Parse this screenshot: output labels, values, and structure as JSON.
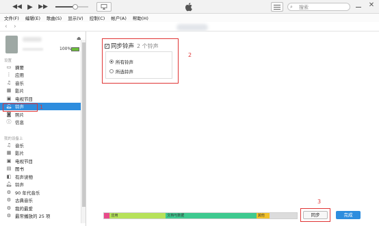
{
  "toolbar": {
    "prev_icon": "rewind-icon",
    "play_icon": "play-icon",
    "next_icon": "fast-forward-icon",
    "volume_level": 0.6,
    "airplay_icon": "airplay-icon",
    "logo_icon": "apple-logo-icon",
    "list_icon": "list-view-icon",
    "search_placeholder": "搜索",
    "search_icon": "search-icon",
    "minimize_icon": "minimize-icon",
    "close_icon": "close-icon"
  },
  "menubar": {
    "items": [
      {
        "label": "文件(F)"
      },
      {
        "label": "编辑(E)"
      },
      {
        "label": "歌曲(S)"
      },
      {
        "label": "显示(V)"
      },
      {
        "label": "控制(C)"
      },
      {
        "label": "帐户(A)"
      },
      {
        "label": "帮助(H)"
      }
    ]
  },
  "navbar": {
    "back_icon": "chevron-left-icon",
    "forward_icon": "chevron-right-icon"
  },
  "device": {
    "battery_label": "100%",
    "battery_level": 1.0,
    "eject_icon": "eject-icon"
  },
  "sidebar": {
    "settings_title": "设置",
    "settings_items": [
      {
        "label": "摘要",
        "icon": "summary-icon"
      },
      {
        "label": "应用",
        "icon": "apps-icon"
      },
      {
        "label": "音乐",
        "icon": "music-icon"
      },
      {
        "label": "影片",
        "icon": "movie-icon"
      },
      {
        "label": "电视节目",
        "icon": "tv-icon"
      },
      {
        "label": "铃声",
        "icon": "bell-icon",
        "selected": true
      },
      {
        "label": "照片",
        "icon": "camera-icon"
      },
      {
        "label": "信息",
        "icon": "info-icon"
      }
    ],
    "ondevice_title": "我的设备上",
    "ondevice_items": [
      {
        "label": "音乐",
        "icon": "music-icon"
      },
      {
        "label": "影片",
        "icon": "movie-icon"
      },
      {
        "label": "电视节目",
        "icon": "tv-icon"
      },
      {
        "label": "图书",
        "icon": "book-icon"
      },
      {
        "label": "有声读物",
        "icon": "audiobook-icon"
      },
      {
        "label": "铃声",
        "icon": "bell-icon"
      },
      {
        "label": "90 年代音乐",
        "icon": "gear-icon"
      },
      {
        "label": "古典音乐",
        "icon": "gear-icon"
      },
      {
        "label": "我的最爱",
        "icon": "gear-icon"
      },
      {
        "label": "最常播放的 25 项",
        "icon": "gear-icon"
      }
    ]
  },
  "annotations": {
    "one": "1",
    "two": "2",
    "three": "3"
  },
  "sync": {
    "checked": true,
    "title": "同步铃声",
    "count": "2 个铃声",
    "options": [
      {
        "label": "所有铃声",
        "selected": true
      },
      {
        "label": "所选铃声",
        "selected": false
      }
    ]
  },
  "capacity": {
    "segments": [
      {
        "label": "",
        "color": "#e84a8a",
        "fraction": 0.03
      },
      {
        "label": "应用",
        "color": "#b6e25a",
        "fraction": 0.29
      },
      {
        "label": "文档与数据",
        "color": "#3ec98f",
        "fraction": 0.47
      },
      {
        "label": "其他",
        "color": "#f2c12a",
        "fraction": 0.07
      },
      {
        "label": "",
        "color": "#dcdcdc",
        "fraction": 0.14
      }
    ]
  },
  "buttons": {
    "sync_label": "同步",
    "done_label": "完成"
  },
  "colors": {
    "accent": "#2e8dde",
    "annotation_red": "#e03434"
  }
}
